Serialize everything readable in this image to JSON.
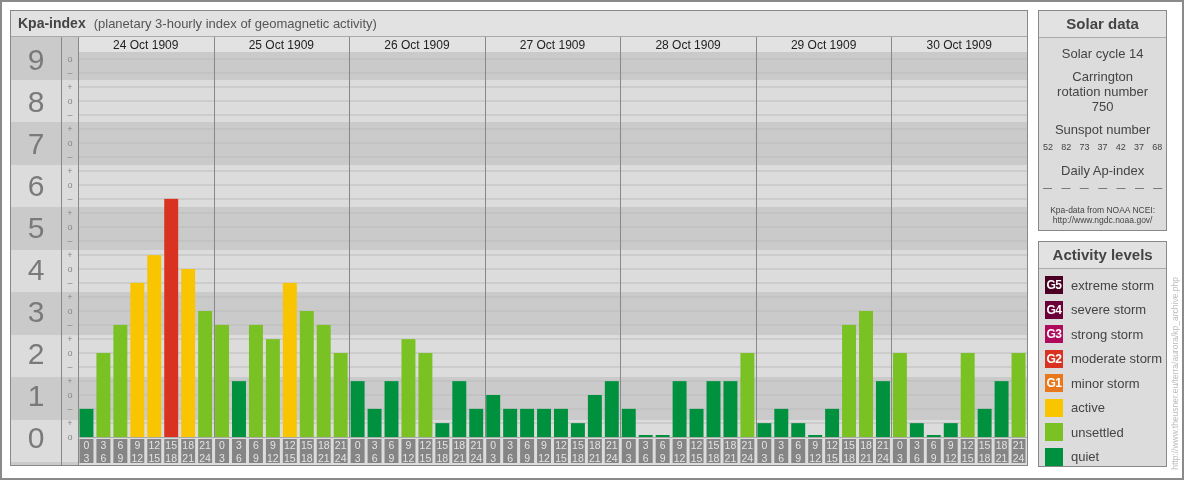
{
  "title": "Kpa-index",
  "subtitle": "(planetary 3-hourly index of geomagnetic activity)",
  "chart": {
    "days": [
      {
        "date": "24 Oct 1909",
        "hours": [
          [
            "0",
            "3"
          ],
          [
            "3",
            "6"
          ],
          [
            "6",
            "9"
          ],
          [
            "9",
            "12"
          ],
          [
            "12",
            "15"
          ],
          [
            "15",
            "18"
          ],
          [
            "18",
            "21"
          ],
          [
            "21",
            "24"
          ]
        ]
      },
      {
        "date": "25 Oct 1909",
        "hours": [
          [
            "0",
            "3"
          ],
          [
            "3",
            "6"
          ],
          [
            "6",
            "9"
          ],
          [
            "9",
            "12"
          ],
          [
            "12",
            "15"
          ],
          [
            "15",
            "18"
          ],
          [
            "18",
            "21"
          ],
          [
            "21",
            "24"
          ]
        ]
      },
      {
        "date": "26 Oct 1909",
        "hours": [
          [
            "0",
            "3"
          ],
          [
            "3",
            "6"
          ],
          [
            "6",
            "9"
          ],
          [
            "9",
            "12"
          ],
          [
            "12",
            "15"
          ],
          [
            "15",
            "18"
          ],
          [
            "18",
            "21"
          ],
          [
            "21",
            "24"
          ]
        ]
      },
      {
        "date": "27 Oct 1909",
        "hours": [
          [
            "0",
            "3"
          ],
          [
            "3",
            "6"
          ],
          [
            "6",
            "9"
          ],
          [
            "9",
            "12"
          ],
          [
            "12",
            "15"
          ],
          [
            "15",
            "18"
          ],
          [
            "18",
            "21"
          ],
          [
            "21",
            "24"
          ]
        ]
      },
      {
        "date": "28 Oct 1909",
        "hours": [
          [
            "0",
            "3"
          ],
          [
            "3",
            "6"
          ],
          [
            "6",
            "9"
          ],
          [
            "9",
            "12"
          ],
          [
            "12",
            "15"
          ],
          [
            "15",
            "18"
          ],
          [
            "18",
            "21"
          ],
          [
            "21",
            "24"
          ]
        ]
      },
      {
        "date": "29 Oct 1909",
        "hours": [
          [
            "0",
            "3"
          ],
          [
            "3",
            "6"
          ],
          [
            "6",
            "9"
          ],
          [
            "9",
            "12"
          ],
          [
            "12",
            "15"
          ],
          [
            "15",
            "18"
          ],
          [
            "18",
            "21"
          ],
          [
            "21",
            "24"
          ]
        ]
      },
      {
        "date": "30 Oct 1909",
        "hours": [
          [
            "0",
            "3"
          ],
          [
            "3",
            "6"
          ],
          [
            "6",
            "9"
          ],
          [
            "9",
            "12"
          ],
          [
            "12",
            "15"
          ],
          [
            "15",
            "18"
          ],
          [
            "18",
            "21"
          ],
          [
            "21",
            "24"
          ]
        ]
      }
    ],
    "subtick_labels": [
      "o",
      "–",
      "+",
      "o",
      "–",
      "+",
      "o",
      "–",
      "+",
      "o",
      "–",
      "+",
      "o",
      "–",
      "+",
      "o",
      "–",
      "+",
      "o",
      "–",
      "+",
      "o",
      "–",
      "+",
      "o",
      "–",
      "+",
      "o"
    ],
    "chart_data": {
      "type": "bar",
      "grid": true,
      "ylim": [
        0,
        9.5
      ],
      "yticks": [
        0,
        1,
        2,
        3,
        4,
        5,
        6,
        7,
        8,
        9
      ],
      "series": [
        {
          "color": "#00913f",
          "values": [
            0.67,
            null,
            null,
            null,
            null,
            null,
            null,
            null,
            null,
            1.33,
            null,
            null,
            null,
            null,
            null,
            null,
            1.33,
            0.67,
            1.33,
            null,
            null,
            0.33,
            1.33,
            0.67,
            1,
            0.67,
            0.67,
            0.67,
            0.67,
            0.33,
            1,
            1.33,
            0.67,
            0,
            0,
            1.33,
            0.67,
            1.33,
            1.33,
            null,
            0.33,
            0.67,
            0.33,
            0,
            0.67,
            null,
            null,
            1.33,
            null,
            0.33,
            0,
            0.33,
            null,
            0.67,
            1.33,
            null
          ]
        },
        {
          "color": "#7ac124",
          "values": [
            null,
            2,
            2.67,
            null,
            null,
            null,
            null,
            3,
            2.67,
            null,
            2.67,
            2.33,
            null,
            3,
            2.67,
            2,
            null,
            null,
            null,
            2.33,
            2,
            null,
            null,
            null,
            null,
            null,
            null,
            null,
            null,
            null,
            null,
            null,
            null,
            null,
            null,
            null,
            null,
            null,
            null,
            2,
            null,
            null,
            null,
            null,
            null,
            2.67,
            3,
            null,
            2,
            null,
            null,
            null,
            2,
            null,
            null,
            2
          ]
        },
        {
          "color": "#f9c400",
          "values": [
            null,
            null,
            null,
            3.67,
            4.33,
            null,
            4,
            null,
            null,
            null,
            null,
            null,
            3.67,
            null,
            null,
            null,
            null,
            null,
            null,
            null,
            null,
            null,
            null,
            null,
            null,
            null,
            null,
            null,
            null,
            null,
            null,
            null,
            null,
            null,
            null,
            null,
            null,
            null,
            null,
            null,
            null,
            null,
            null,
            null,
            null,
            null,
            null,
            null,
            null,
            null,
            null,
            null,
            null,
            null,
            null,
            null
          ]
        },
        {
          "color": "#d93220",
          "values": [
            null,
            null,
            null,
            null,
            null,
            5.67,
            null,
            null,
            null,
            null,
            null,
            null,
            null,
            null,
            null,
            null,
            null,
            null,
            null,
            null,
            null,
            null,
            null,
            null,
            null,
            null,
            null,
            null,
            null,
            null,
            null,
            null,
            null,
            null,
            null,
            null,
            null,
            null,
            null,
            null,
            null,
            null,
            null,
            null,
            null,
            null,
            null,
            null,
            null,
            null,
            null,
            null,
            null,
            null,
            null,
            null
          ]
        }
      ]
    }
  },
  "solar": {
    "title": "Solar data",
    "cycle": "Solar cycle 14",
    "rotation": "Carrington rotation number 750",
    "sunspot_title": "Sunspot number",
    "sunspots": [
      "52",
      "82",
      "73",
      "37",
      "42",
      "37",
      "68"
    ],
    "ap_title": "Daily Ap-index",
    "ap": [
      "—",
      "—",
      "—",
      "—",
      "—",
      "—",
      "—"
    ],
    "source": "Kpa-data from NOAA NCEI:",
    "source_url": "http://www.ngdc.noaa.gov/"
  },
  "legend": {
    "title": "Activity levels",
    "items": [
      {
        "code": "G5",
        "label": "extreme storm",
        "color": "#4a0022"
      },
      {
        "code": "G4",
        "label": "severe storm",
        "color": "#6b0038"
      },
      {
        "code": "G3",
        "label": "strong storm",
        "color": "#b00a5c"
      },
      {
        "code": "G2",
        "label": "moderate storm",
        "color": "#d93220"
      },
      {
        "code": "G1",
        "label": "minor storm",
        "color": "#e8781c"
      },
      {
        "label": "active",
        "color": "#f9c400"
      },
      {
        "label": "unsettled",
        "color": "#7ac124"
      },
      {
        "label": "quiet",
        "color": "#00913f"
      }
    ]
  },
  "credit": "http://www.theusner.eu/terra/aurora/kp_archive.php"
}
